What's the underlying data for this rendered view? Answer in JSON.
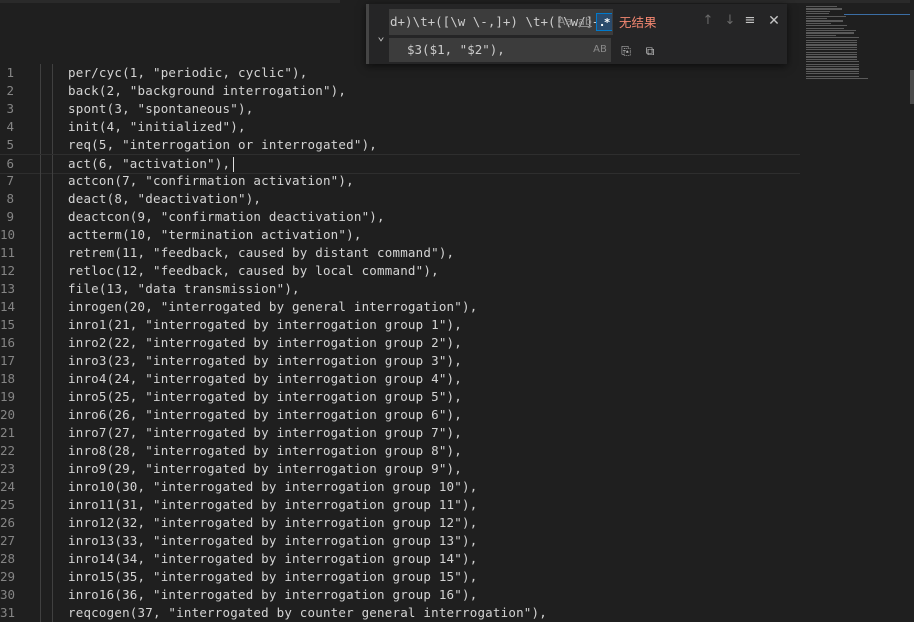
{
  "editor": {
    "lines": [
      {
        "num": "1",
        "code": "per/cyc(1, \"periodic, cyclic\"),"
      },
      {
        "num": "2",
        "code": "back(2, \"background interrogation\"),"
      },
      {
        "num": "3",
        "code": "spont(3, \"spontaneous\"),"
      },
      {
        "num": "4",
        "code": "init(4, \"initialized\"),"
      },
      {
        "num": "5",
        "code": "req(5, \"interrogation or interrogated\"),"
      },
      {
        "num": "6",
        "code": "act(6, \"activation\"),"
      },
      {
        "num": "7",
        "code": "actcon(7, \"confirmation activation\"),"
      },
      {
        "num": "8",
        "code": "deact(8, \"deactivation\"),"
      },
      {
        "num": "9",
        "code": "deactcon(9, \"confirmation deactivation\"),"
      },
      {
        "num": "10",
        "code": "actterm(10, \"termination activation\"),"
      },
      {
        "num": "11",
        "code": "retrem(11, \"feedback, caused by distant command\"),"
      },
      {
        "num": "12",
        "code": "retloc(12, \"feedback, caused by local command\"),"
      },
      {
        "num": "13",
        "code": "file(13, \"data transmission\"),"
      },
      {
        "num": "14",
        "code": "inrogen(20, \"interrogated by general interrogation\"),"
      },
      {
        "num": "15",
        "code": "inro1(21, \"interrogated by interrogation group 1\"),"
      },
      {
        "num": "16",
        "code": "inro2(22, \"interrogated by interrogation group 2\"),"
      },
      {
        "num": "17",
        "code": "inro3(23, \"interrogated by interrogation group 3\"),"
      },
      {
        "num": "18",
        "code": "inro4(24, \"interrogated by interrogation group 4\"),"
      },
      {
        "num": "19",
        "code": "inro5(25, \"interrogated by interrogation group 5\"),"
      },
      {
        "num": "20",
        "code": "inro6(26, \"interrogated by interrogation group 6\"),"
      },
      {
        "num": "21",
        "code": "inro7(27, \"interrogated by interrogation group 7\"),"
      },
      {
        "num": "22",
        "code": "inro8(28, \"interrogated by interrogation group 8\"),"
      },
      {
        "num": "23",
        "code": "inro9(29, \"interrogated by interrogation group 9\"),"
      },
      {
        "num": "24",
        "code": "inro10(30, \"interrogated by interrogation group 10\"),"
      },
      {
        "num": "25",
        "code": "inro11(31, \"interrogated by interrogation group 11\"),"
      },
      {
        "num": "26",
        "code": "inro12(32, \"interrogated by interrogation group 12\"),"
      },
      {
        "num": "27",
        "code": "inro13(33, \"interrogated by interrogation group 13\"),"
      },
      {
        "num": "28",
        "code": "inro14(34, \"interrogated by interrogation group 14\"),"
      },
      {
        "num": "29",
        "code": "inro15(35, \"interrogated by interrogation group 15\"),"
      },
      {
        "num": "30",
        "code": "inro16(36, \"interrogated by interrogation group 16\"),"
      },
      {
        "num": "31",
        "code": "reqcogen(37, \"interrogated by counter general interrogation\"),"
      }
    ],
    "current_line": 6
  },
  "find": {
    "search_value": "d+)\\t+([\\w \\-,]+) \\t+([\\w/]+",
    "match_case_label": "Aa",
    "whole_word_label": "ab",
    "regex_label": ".*",
    "results_text": "无结果",
    "prev_icon": "↑",
    "next_icon": "↓",
    "selection_icon": "≡",
    "close_icon": "✕",
    "toggle_icon": "⌄",
    "replace_value": "$3($1, \"$2\"),",
    "preserve_case_label": "AB",
    "replace_one_icon": "⎘",
    "replace_all_icon": "⧉"
  },
  "colors": {
    "background": "#1f1f1f",
    "no_results": "#f48771",
    "regex_active": "#007acc"
  }
}
